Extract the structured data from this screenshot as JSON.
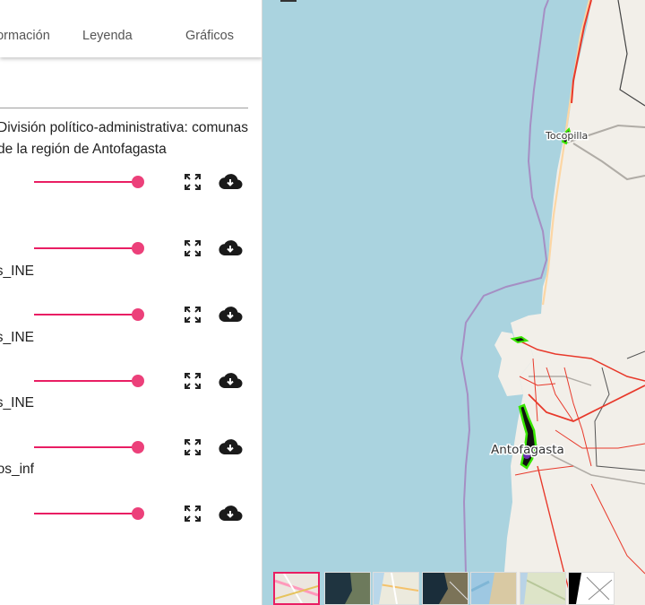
{
  "tabs": [
    {
      "label": "Información"
    },
    {
      "label": "Leyenda"
    },
    {
      "label": "Gráficos"
    }
  ],
  "group": {
    "title": "División político-administrativa: comunas de la región de Antofagasta"
  },
  "layers": [
    {
      "label": "",
      "opacity": 0.95
    },
    {
      "label": "Manzanas_INE",
      "opacity": 0.95
    },
    {
      "label": "Distritos_INE",
      "opacity": 0.95
    },
    {
      "label": "Localidades_INE",
      "opacity": 0.95
    },
    {
      "label": "Asentamientos_inf",
      "opacity": 0.95
    },
    {
      "label": "",
      "opacity": 0.95
    }
  ],
  "map": {
    "places": {
      "tocopilla": "Tocopilla",
      "antofagasta": "Antofagasta"
    },
    "colors": {
      "sea": "#aad3df",
      "land": "#f2efe9",
      "primary_road": "#e8392b",
      "secondary_road": "#fcd6a4",
      "boundary": "#a58fc4",
      "highlight": "#39e600"
    }
  },
  "basemaps": [
    {
      "name": "OpenStreetMap",
      "selected": true
    },
    {
      "name": "Esri Imagery",
      "selected": false
    },
    {
      "name": "Esri Streets",
      "selected": false
    },
    {
      "name": "Esri Topo Imagery",
      "selected": false
    },
    {
      "name": "Esri Ocean",
      "selected": false
    },
    {
      "name": "Esri Topographic",
      "selected": false
    },
    {
      "name": "Stamen Toner",
      "selected": false
    }
  ]
}
